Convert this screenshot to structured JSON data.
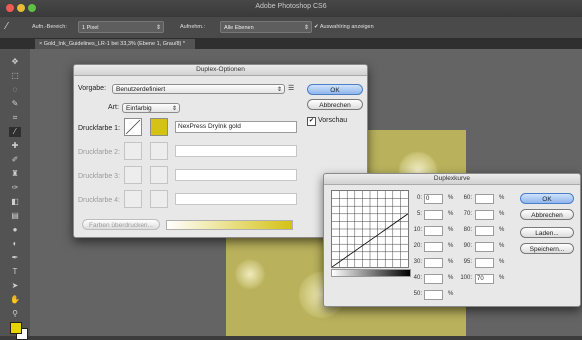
{
  "window": {
    "title": "Adobe Photoshop CS6"
  },
  "options_bar": {
    "sample_size_label": "Aufn.-Bereich:",
    "sample_size_value": "1 Pixel",
    "sample_label": "Aufnehm.:",
    "sample_value": "Alle Ebenen",
    "show_ring_label": "Auswahlring anzeigen"
  },
  "document_tab": {
    "label": "Gold_Ink_Guidelines_LR-1 bei 33,3% (Ebene 1, Grau/8) *"
  },
  "duplex_dialog": {
    "title": "Duplex-Optionen",
    "preset_label": "Vorgabe:",
    "preset_value": "Benutzerdefiniert",
    "type_label": "Art:",
    "type_value": "Einfarbig",
    "ok_label": "OK",
    "cancel_label": "Abbrechen",
    "preview_label": "Vorschau",
    "inks": [
      {
        "label": "Druckfarbe 1:",
        "name": "NexPress DryInk gold",
        "color": "#d4c214"
      },
      {
        "label": "Druckfarbe 2:",
        "name": ""
      },
      {
        "label": "Druckfarbe 3:",
        "name": ""
      },
      {
        "label": "Druckfarbe 4:",
        "name": ""
      }
    ],
    "overprint_label": "Farben überdrucken..."
  },
  "curve_dialog": {
    "title": "Duplexkurve",
    "fields": [
      {
        "label": "0:",
        "value": "0"
      },
      {
        "label": "60:",
        "value": ""
      },
      {
        "label": "5:",
        "value": ""
      },
      {
        "label": "70:",
        "value": ""
      },
      {
        "label": "10:",
        "value": ""
      },
      {
        "label": "80:",
        "value": ""
      },
      {
        "label": "20:",
        "value": ""
      },
      {
        "label": "90:",
        "value": ""
      },
      {
        "label": "30:",
        "value": ""
      },
      {
        "label": "95:",
        "value": ""
      },
      {
        "label": "40:",
        "value": ""
      },
      {
        "label": "100:",
        "value": "70"
      },
      {
        "label": "50:",
        "value": ""
      }
    ],
    "percent": "%",
    "ok_label": "OK",
    "cancel_label": "Abbrechen",
    "load_label": "Laden...",
    "save_label": "Speichern..."
  },
  "colors": {
    "ink_gold": "#d4c214",
    "foreground": "#e8d500",
    "background": "#ffffff"
  }
}
